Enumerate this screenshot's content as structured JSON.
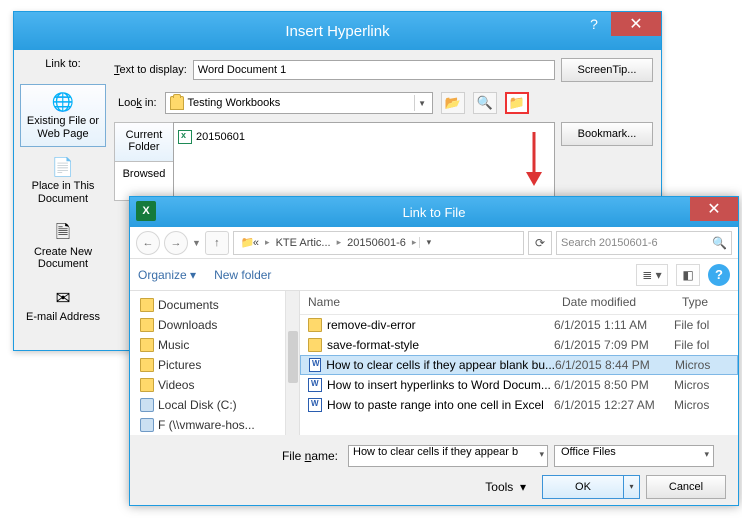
{
  "dlg1": {
    "title": "Insert Hyperlink",
    "linkto_label": "Link to:",
    "text_to_display_label": "Text to display:",
    "text_to_display_value": "Word Document 1",
    "screentip_btn": "ScreenTip...",
    "lookin_label": "Look in:",
    "lookin_value": "Testing Workbooks",
    "bookmark_btn": "Bookmark...",
    "left_items": [
      {
        "icon": "🌐",
        "label": "Existing File or Web Page",
        "selected": true
      },
      {
        "icon": "📄",
        "label": "Place in This Document",
        "selected": false
      },
      {
        "icon": "🗎",
        "label": "Create New Document",
        "selected": false
      },
      {
        "icon": "✉",
        "label": "E-mail Address",
        "selected": false
      }
    ],
    "list_tabs": [
      {
        "label": "Current Folder",
        "selected": true
      },
      {
        "label": "Browsed"
      }
    ],
    "file_in_list": "20150601"
  },
  "dlg2": {
    "title": "Link to File",
    "breadcrumbs": [
      "«",
      "KTE Artic...",
      "20150601-6"
    ],
    "search_placeholder": "Search 20150601-6",
    "organize": "Organize",
    "new_folder": "New folder",
    "tree": [
      "Documents",
      "Downloads",
      "Music",
      "Pictures",
      "Videos",
      "Local Disk (C:)",
      "F (\\\\vmware-hos..."
    ],
    "columns": {
      "c1": "Name",
      "c2": "Date modified",
      "c3": "Type"
    },
    "rows": [
      {
        "icon": "folder",
        "name": "remove-div-error",
        "date": "6/1/2015 1:11 AM",
        "type": "File fol",
        "selected": false
      },
      {
        "icon": "folder",
        "name": "save-format-style",
        "date": "6/1/2015 7:09 PM",
        "type": "File fol",
        "selected": false
      },
      {
        "icon": "docx",
        "name": "How to clear cells if they appear blank bu...",
        "date": "6/1/2015 8:44 PM",
        "type": "Micros",
        "selected": true
      },
      {
        "icon": "docx",
        "name": "How to insert hyperlinks to Word Docum...",
        "date": "6/1/2015 8:50 PM",
        "type": "Micros",
        "selected": false
      },
      {
        "icon": "docx",
        "name": "How to paste range into one cell in Excel",
        "date": "6/1/2015 12:27 AM",
        "type": "Micros",
        "selected": false
      }
    ],
    "filename_label": "File name:",
    "filename_value": "How to clear cells if they appear b",
    "filter_value": "Office Files",
    "tools": "Tools",
    "ok": "OK",
    "cancel": "Cancel"
  }
}
